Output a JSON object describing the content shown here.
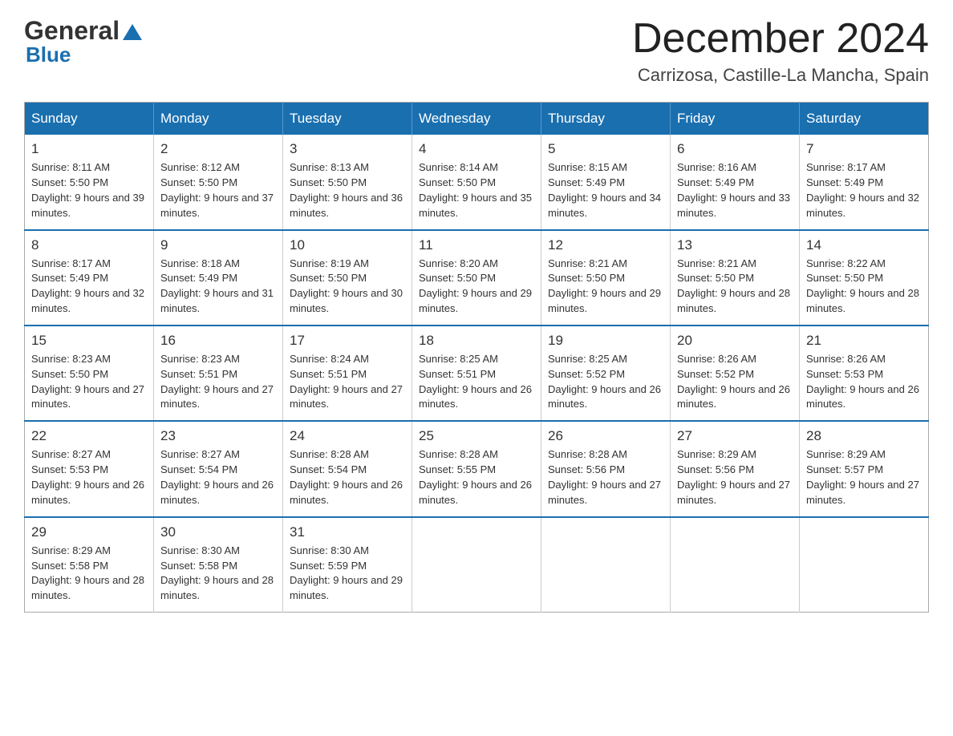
{
  "header": {
    "logo": {
      "general": "General",
      "blue": "Blue"
    },
    "title": "December 2024",
    "location": "Carrizosa, Castille-La Mancha, Spain"
  },
  "days_of_week": [
    "Sunday",
    "Monday",
    "Tuesday",
    "Wednesday",
    "Thursday",
    "Friday",
    "Saturday"
  ],
  "weeks": [
    [
      {
        "day": "1",
        "sunrise": "8:11 AM",
        "sunset": "5:50 PM",
        "daylight": "9 hours and 39 minutes."
      },
      {
        "day": "2",
        "sunrise": "8:12 AM",
        "sunset": "5:50 PM",
        "daylight": "9 hours and 37 minutes."
      },
      {
        "day": "3",
        "sunrise": "8:13 AM",
        "sunset": "5:50 PM",
        "daylight": "9 hours and 36 minutes."
      },
      {
        "day": "4",
        "sunrise": "8:14 AM",
        "sunset": "5:50 PM",
        "daylight": "9 hours and 35 minutes."
      },
      {
        "day": "5",
        "sunrise": "8:15 AM",
        "sunset": "5:49 PM",
        "daylight": "9 hours and 34 minutes."
      },
      {
        "day": "6",
        "sunrise": "8:16 AM",
        "sunset": "5:49 PM",
        "daylight": "9 hours and 33 minutes."
      },
      {
        "day": "7",
        "sunrise": "8:17 AM",
        "sunset": "5:49 PM",
        "daylight": "9 hours and 32 minutes."
      }
    ],
    [
      {
        "day": "8",
        "sunrise": "8:17 AM",
        "sunset": "5:49 PM",
        "daylight": "9 hours and 32 minutes."
      },
      {
        "day": "9",
        "sunrise": "8:18 AM",
        "sunset": "5:49 PM",
        "daylight": "9 hours and 31 minutes."
      },
      {
        "day": "10",
        "sunrise": "8:19 AM",
        "sunset": "5:50 PM",
        "daylight": "9 hours and 30 minutes."
      },
      {
        "day": "11",
        "sunrise": "8:20 AM",
        "sunset": "5:50 PM",
        "daylight": "9 hours and 29 minutes."
      },
      {
        "day": "12",
        "sunrise": "8:21 AM",
        "sunset": "5:50 PM",
        "daylight": "9 hours and 29 minutes."
      },
      {
        "day": "13",
        "sunrise": "8:21 AM",
        "sunset": "5:50 PM",
        "daylight": "9 hours and 28 minutes."
      },
      {
        "day": "14",
        "sunrise": "8:22 AM",
        "sunset": "5:50 PM",
        "daylight": "9 hours and 28 minutes."
      }
    ],
    [
      {
        "day": "15",
        "sunrise": "8:23 AM",
        "sunset": "5:50 PM",
        "daylight": "9 hours and 27 minutes."
      },
      {
        "day": "16",
        "sunrise": "8:23 AM",
        "sunset": "5:51 PM",
        "daylight": "9 hours and 27 minutes."
      },
      {
        "day": "17",
        "sunrise": "8:24 AM",
        "sunset": "5:51 PM",
        "daylight": "9 hours and 27 minutes."
      },
      {
        "day": "18",
        "sunrise": "8:25 AM",
        "sunset": "5:51 PM",
        "daylight": "9 hours and 26 minutes."
      },
      {
        "day": "19",
        "sunrise": "8:25 AM",
        "sunset": "5:52 PM",
        "daylight": "9 hours and 26 minutes."
      },
      {
        "day": "20",
        "sunrise": "8:26 AM",
        "sunset": "5:52 PM",
        "daylight": "9 hours and 26 minutes."
      },
      {
        "day": "21",
        "sunrise": "8:26 AM",
        "sunset": "5:53 PM",
        "daylight": "9 hours and 26 minutes."
      }
    ],
    [
      {
        "day": "22",
        "sunrise": "8:27 AM",
        "sunset": "5:53 PM",
        "daylight": "9 hours and 26 minutes."
      },
      {
        "day": "23",
        "sunrise": "8:27 AM",
        "sunset": "5:54 PM",
        "daylight": "9 hours and 26 minutes."
      },
      {
        "day": "24",
        "sunrise": "8:28 AM",
        "sunset": "5:54 PM",
        "daylight": "9 hours and 26 minutes."
      },
      {
        "day": "25",
        "sunrise": "8:28 AM",
        "sunset": "5:55 PM",
        "daylight": "9 hours and 26 minutes."
      },
      {
        "day": "26",
        "sunrise": "8:28 AM",
        "sunset": "5:56 PM",
        "daylight": "9 hours and 27 minutes."
      },
      {
        "day": "27",
        "sunrise": "8:29 AM",
        "sunset": "5:56 PM",
        "daylight": "9 hours and 27 minutes."
      },
      {
        "day": "28",
        "sunrise": "8:29 AM",
        "sunset": "5:57 PM",
        "daylight": "9 hours and 27 minutes."
      }
    ],
    [
      {
        "day": "29",
        "sunrise": "8:29 AM",
        "sunset": "5:58 PM",
        "daylight": "9 hours and 28 minutes."
      },
      {
        "day": "30",
        "sunrise": "8:30 AM",
        "sunset": "5:58 PM",
        "daylight": "9 hours and 28 minutes."
      },
      {
        "day": "31",
        "sunrise": "8:30 AM",
        "sunset": "5:59 PM",
        "daylight": "9 hours and 29 minutes."
      },
      null,
      null,
      null,
      null
    ]
  ],
  "labels": {
    "sunrise_prefix": "Sunrise: ",
    "sunset_prefix": "Sunset: ",
    "daylight_prefix": "Daylight: "
  }
}
